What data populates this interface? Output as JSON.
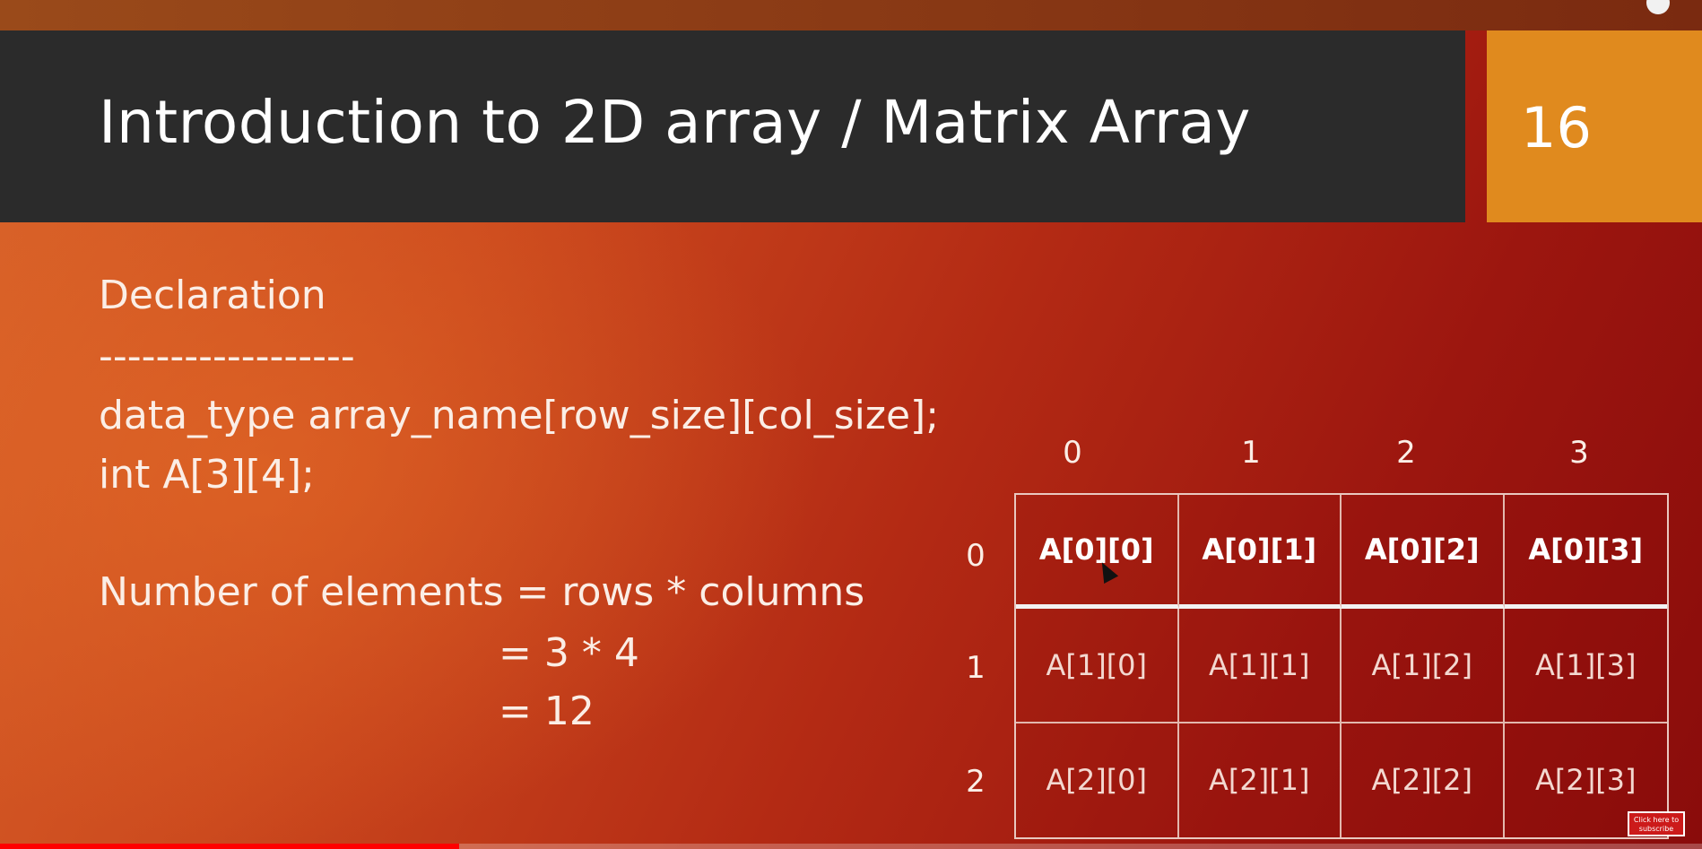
{
  "slide": {
    "title": "Introduction to 2D array / Matrix Array",
    "number": "16"
  },
  "content": {
    "heading": "Declaration",
    "divider": "------------------",
    "syntax": "data_type array_name[row_size][col_size];",
    "example": "int A[3][4];",
    "count_line": "Number of elements = rows * columns",
    "count_step1": "= 3 * 4",
    "count_step2": "= 12"
  },
  "matrix": {
    "col_headers": [
      "0",
      "1",
      "2",
      "3"
    ],
    "row_headers": [
      "0",
      "1",
      "2"
    ],
    "rows": [
      [
        "A[0][0]",
        "A[0][1]",
        "A[0][2]",
        "A[0][3]"
      ],
      [
        "A[1][0]",
        "A[1][1]",
        "A[1][2]",
        "A[1][3]"
      ],
      [
        "A[2][0]",
        "A[2][1]",
        "A[2][2]",
        "A[2][3]"
      ]
    ]
  },
  "video": {
    "subscribe_label": "Click here to subscribe",
    "progress_fraction": 0.27
  },
  "colors": {
    "title_bar": "#2b2b2b",
    "slide_number_box": "#e08a1e",
    "progress": "#ff0000"
  }
}
